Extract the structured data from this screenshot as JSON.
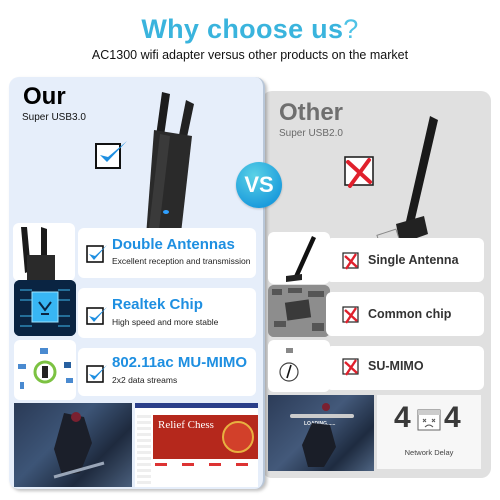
{
  "header": {
    "title": "Why choose us",
    "title_mark": "?",
    "subtitle": "AC1300 wifi adapter versus other products on the market"
  },
  "vs_badge": "VS",
  "ours": {
    "heading": "Our",
    "usb": "Super USB3.0",
    "features": [
      {
        "title": "Double Antennas",
        "desc": "Excellent reception and transmission",
        "icon": "check-icon"
      },
      {
        "title": "Realtek Chip",
        "desc": "High speed and more stable",
        "icon": "check-icon"
      },
      {
        "title": "802.11ac MU-MIMO",
        "desc": "2x2 data streams",
        "icon": "check-icon"
      }
    ],
    "shop_banner": "Relief Chess"
  },
  "other": {
    "heading": "Other",
    "usb": "Super USB2.0",
    "features": [
      {
        "title": "Single Antenna",
        "icon": "cross-icon"
      },
      {
        "title": "Common chip",
        "icon": "cross-icon"
      },
      {
        "title": "SU-MIMO",
        "icon": "cross-icon"
      }
    ],
    "loading_text": "LOADING......",
    "delay_digits": [
      "4",
      "4"
    ],
    "delay_label": "Network Delay"
  },
  "colors": {
    "accent_blue": "#1e8fe1",
    "title_cyan": "#3ab4dd",
    "cross_red": "#e0202c",
    "left_card": "#e6eefa",
    "right_card": "#e0e0e0"
  }
}
